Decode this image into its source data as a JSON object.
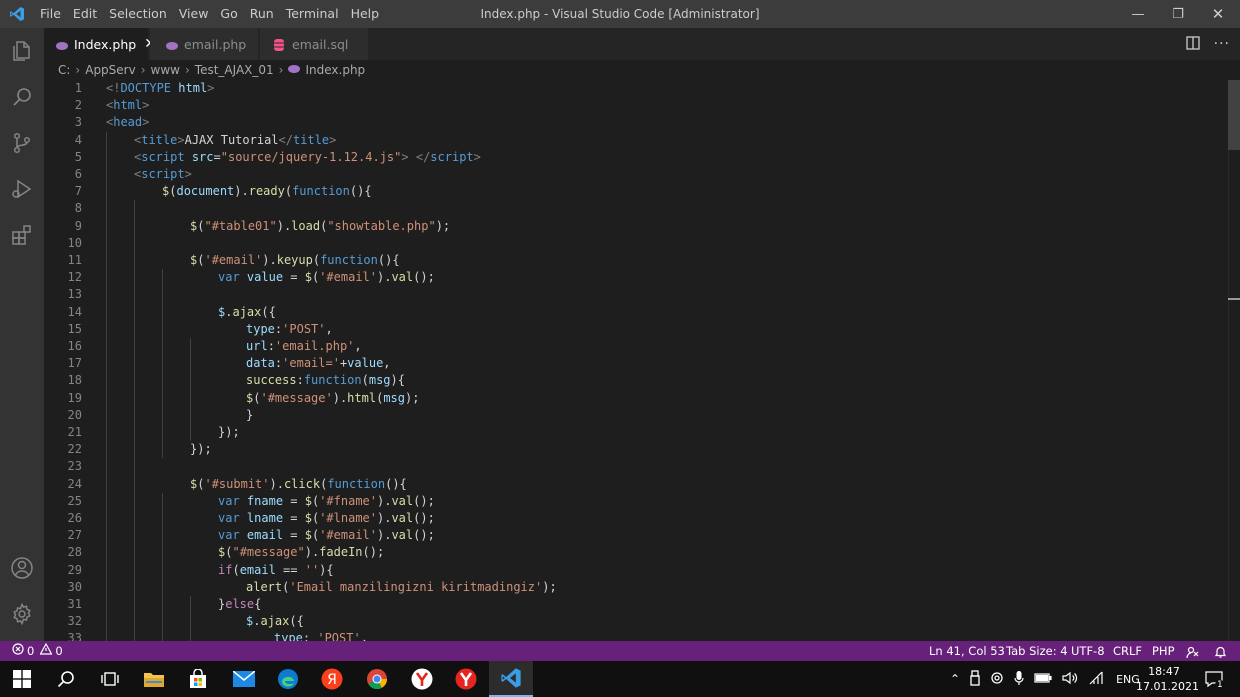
{
  "titlebar": {
    "menu": [
      "File",
      "Edit",
      "Selection",
      "View",
      "Go",
      "Run",
      "Terminal",
      "Help"
    ],
    "window_title": "Index.php - Visual Studio Code [Administrator]",
    "minimize_glyph": "—",
    "restore_glyph": "❐",
    "close_glyph": "✕"
  },
  "activity": [
    "explorer-icon",
    "search-icon",
    "source-control-icon",
    "run-debug-icon",
    "extensions-icon",
    "account-icon",
    "settings-gear-icon"
  ],
  "tabs": [
    {
      "label": "Index.php",
      "active": true,
      "icon": "php-file-icon",
      "icon_color": "#a074c4"
    },
    {
      "label": "email.php",
      "active": false,
      "icon": "php-file-icon",
      "icon_color": "#a074c4"
    },
    {
      "label": "email.sql",
      "active": false,
      "icon": "database-icon",
      "icon_color": "#f55385"
    }
  ],
  "breadcrumb": [
    "C:",
    "AppServ",
    "www",
    "Test_AJAX_01",
    "Index.php"
  ],
  "editor": {
    "lines": [
      {
        "n": "1",
        "indent": 0,
        "t": [
          [
            "t",
            "<!"
          ],
          [
            "tag",
            "DOCTYPE"
          ],
          [
            "txt",
            " "
          ],
          [
            "attr",
            "html"
          ],
          [
            "t",
            ">"
          ]
        ]
      },
      {
        "n": "2",
        "indent": 0,
        "t": [
          [
            "t",
            "<"
          ],
          [
            "tag",
            "html"
          ],
          [
            "t",
            ">"
          ]
        ]
      },
      {
        "n": "3",
        "indent": 0,
        "t": [
          [
            "t",
            "<"
          ],
          [
            "tag",
            "head"
          ],
          [
            "t",
            ">"
          ]
        ]
      },
      {
        "n": "4",
        "indent": 1,
        "t": [
          [
            "t",
            "<"
          ],
          [
            "tag",
            "title"
          ],
          [
            "t",
            ">"
          ],
          [
            "txt",
            "AJAX Tutorial"
          ],
          [
            "t",
            "</"
          ],
          [
            "tag",
            "title"
          ],
          [
            "t",
            ">"
          ]
        ]
      },
      {
        "n": "5",
        "indent": 1,
        "t": [
          [
            "t",
            "<"
          ],
          [
            "tag",
            "script"
          ],
          [
            "txt",
            " "
          ],
          [
            "attr",
            "src"
          ],
          [
            "pun",
            "="
          ],
          [
            "str",
            "\"source/jquery-1.12.4.js\""
          ],
          [
            "t",
            ">"
          ],
          [
            "txt",
            " "
          ],
          [
            "t",
            "</"
          ],
          [
            "tag",
            "script"
          ],
          [
            "t",
            ">"
          ]
        ]
      },
      {
        "n": "6",
        "indent": 1,
        "t": [
          [
            "t",
            "<"
          ],
          [
            "tag",
            "script"
          ],
          [
            "t",
            ">"
          ]
        ]
      },
      {
        "n": "7",
        "indent": 2,
        "t": [
          [
            "fn",
            "$"
          ],
          [
            "pun",
            "("
          ],
          [
            "var",
            "document"
          ],
          [
            "pun",
            ")."
          ],
          [
            "fn",
            "ready"
          ],
          [
            "pun",
            "("
          ],
          [
            "kw",
            "function"
          ],
          [
            "pun",
            "(){"
          ]
        ]
      },
      {
        "n": "8",
        "indent": 0,
        "t": []
      },
      {
        "n": "9",
        "indent": 3,
        "t": [
          [
            "fn",
            "$"
          ],
          [
            "pun",
            "("
          ],
          [
            "str",
            "\"#table01\""
          ],
          [
            "pun",
            ")."
          ],
          [
            "fn",
            "load"
          ],
          [
            "pun",
            "("
          ],
          [
            "str",
            "\"showtable.php\""
          ],
          [
            "pun",
            ");"
          ]
        ]
      },
      {
        "n": "10",
        "indent": 0,
        "t": []
      },
      {
        "n": "11",
        "indent": 3,
        "t": [
          [
            "fn",
            "$"
          ],
          [
            "pun",
            "("
          ],
          [
            "str",
            "'#email'"
          ],
          [
            "pun",
            ")."
          ],
          [
            "fn",
            "keyup"
          ],
          [
            "pun",
            "("
          ],
          [
            "kw",
            "function"
          ],
          [
            "pun",
            "(){"
          ]
        ]
      },
      {
        "n": "12",
        "indent": 4,
        "t": [
          [
            "kw",
            "var"
          ],
          [
            "txt",
            " "
          ],
          [
            "var",
            "value"
          ],
          [
            "pun",
            " = "
          ],
          [
            "fn",
            "$"
          ],
          [
            "pun",
            "("
          ],
          [
            "str",
            "'#email'"
          ],
          [
            "pun",
            ")."
          ],
          [
            "fn",
            "val"
          ],
          [
            "pun",
            "();"
          ]
        ]
      },
      {
        "n": "13",
        "indent": 0,
        "t": []
      },
      {
        "n": "14",
        "indent": 4,
        "t": [
          [
            "var",
            "$"
          ],
          [
            "pun",
            "."
          ],
          [
            "fn",
            "ajax"
          ],
          [
            "pun",
            "({"
          ]
        ]
      },
      {
        "n": "15",
        "indent": 5,
        "t": [
          [
            "var",
            "type"
          ],
          [
            "pun",
            ":"
          ],
          [
            "str",
            "'POST'"
          ],
          [
            "pun",
            ","
          ]
        ]
      },
      {
        "n": "16",
        "indent": 5,
        "t": [
          [
            "var",
            "url"
          ],
          [
            "pun",
            ":"
          ],
          [
            "str",
            "'email.php'"
          ],
          [
            "pun",
            ","
          ]
        ]
      },
      {
        "n": "17",
        "indent": 5,
        "t": [
          [
            "var",
            "data"
          ],
          [
            "pun",
            ":"
          ],
          [
            "str",
            "'email='"
          ],
          [
            "pun",
            "+"
          ],
          [
            "var",
            "value"
          ],
          [
            "pun",
            ","
          ]
        ]
      },
      {
        "n": "18",
        "indent": 5,
        "t": [
          [
            "fn",
            "success"
          ],
          [
            "pun",
            ":"
          ],
          [
            "kw",
            "function"
          ],
          [
            "pun",
            "("
          ],
          [
            "var",
            "msg"
          ],
          [
            "pun",
            "){"
          ]
        ]
      },
      {
        "n": "19",
        "indent": 5,
        "t": [
          [
            "fn",
            "$"
          ],
          [
            "pun",
            "("
          ],
          [
            "str",
            "'#message'"
          ],
          [
            "pun",
            ")."
          ],
          [
            "fn",
            "html"
          ],
          [
            "pun",
            "("
          ],
          [
            "var",
            "msg"
          ],
          [
            "pun",
            ");"
          ]
        ]
      },
      {
        "n": "20",
        "indent": 5,
        "t": [
          [
            "pun",
            "}"
          ]
        ]
      },
      {
        "n": "21",
        "indent": 4,
        "t": [
          [
            "pun",
            "});"
          ]
        ]
      },
      {
        "n": "22",
        "indent": 3,
        "t": [
          [
            "pun",
            "});"
          ]
        ]
      },
      {
        "n": "23",
        "indent": 0,
        "t": []
      },
      {
        "n": "24",
        "indent": 3,
        "t": [
          [
            "fn",
            "$"
          ],
          [
            "pun",
            "("
          ],
          [
            "str",
            "'#submit'"
          ],
          [
            "pun",
            ")."
          ],
          [
            "fn",
            "click"
          ],
          [
            "pun",
            "("
          ],
          [
            "kw",
            "function"
          ],
          [
            "pun",
            "(){"
          ]
        ]
      },
      {
        "n": "25",
        "indent": 4,
        "t": [
          [
            "kw",
            "var"
          ],
          [
            "txt",
            " "
          ],
          [
            "var",
            "fname"
          ],
          [
            "pun",
            " = "
          ],
          [
            "fn",
            "$"
          ],
          [
            "pun",
            "("
          ],
          [
            "str",
            "'#fname'"
          ],
          [
            "pun",
            ")."
          ],
          [
            "fn",
            "val"
          ],
          [
            "pun",
            "();"
          ]
        ]
      },
      {
        "n": "26",
        "indent": 4,
        "t": [
          [
            "kw",
            "var"
          ],
          [
            "txt",
            " "
          ],
          [
            "var",
            "lname"
          ],
          [
            "pun",
            " = "
          ],
          [
            "fn",
            "$"
          ],
          [
            "pun",
            "("
          ],
          [
            "str",
            "'#lname'"
          ],
          [
            "pun",
            ")."
          ],
          [
            "fn",
            "val"
          ],
          [
            "pun",
            "();"
          ]
        ]
      },
      {
        "n": "27",
        "indent": 4,
        "t": [
          [
            "kw",
            "var"
          ],
          [
            "txt",
            " "
          ],
          [
            "var",
            "email"
          ],
          [
            "pun",
            " = "
          ],
          [
            "fn",
            "$"
          ],
          [
            "pun",
            "("
          ],
          [
            "str",
            "'#email'"
          ],
          [
            "pun",
            ")."
          ],
          [
            "fn",
            "val"
          ],
          [
            "pun",
            "();"
          ]
        ]
      },
      {
        "n": "28",
        "indent": 4,
        "t": [
          [
            "fn",
            "$"
          ],
          [
            "pun",
            "("
          ],
          [
            "str",
            "\"#message\""
          ],
          [
            "pun",
            ")."
          ],
          [
            "fn",
            "fadeIn"
          ],
          [
            "pun",
            "();"
          ]
        ]
      },
      {
        "n": "29",
        "indent": 4,
        "t": [
          [
            "ctl",
            "if"
          ],
          [
            "pun",
            "("
          ],
          [
            "var",
            "email"
          ],
          [
            "pun",
            " == "
          ],
          [
            "str",
            "''"
          ],
          [
            "pun",
            "){"
          ]
        ]
      },
      {
        "n": "30",
        "indent": 5,
        "t": [
          [
            "fn",
            "alert"
          ],
          [
            "pun",
            "("
          ],
          [
            "str",
            "'Email manzilingizni kiritmadingiz'"
          ],
          [
            "pun",
            ");"
          ]
        ]
      },
      {
        "n": "31",
        "indent": 4,
        "t": [
          [
            "pun",
            "}"
          ],
          [
            "ctl",
            "else"
          ],
          [
            "pun",
            "{"
          ]
        ]
      },
      {
        "n": "32",
        "indent": 5,
        "t": [
          [
            "var",
            "$"
          ],
          [
            "pun",
            "."
          ],
          [
            "fn",
            "ajax"
          ],
          [
            "pun",
            "({"
          ]
        ]
      },
      {
        "n": "33",
        "indent": 6,
        "t": [
          [
            "var",
            "type"
          ],
          [
            "pun",
            ": "
          ],
          [
            "str",
            "'POST'"
          ],
          [
            "pun",
            ","
          ]
        ]
      }
    ]
  },
  "statusbar": {
    "errors": "0",
    "warnings": "0",
    "position": "Ln 41, Col 53",
    "tab_size": "Tab Size: 4",
    "encoding": "UTF-8",
    "eol": "CRLF",
    "language": "PHP"
  },
  "taskbar": {
    "apps": [
      "windows-start-icon",
      "search-icon",
      "task-view-icon",
      "file-explorer-icon",
      "store-icon",
      "mail-icon",
      "edge-icon",
      "yandex-icon",
      "chrome-icon",
      "yandex-browser-icon",
      "yandex-browser-2-icon",
      "vscode-icon"
    ],
    "language": "ENG",
    "time": "18:47",
    "date": "17.01.2021",
    "notification_count": "1"
  }
}
